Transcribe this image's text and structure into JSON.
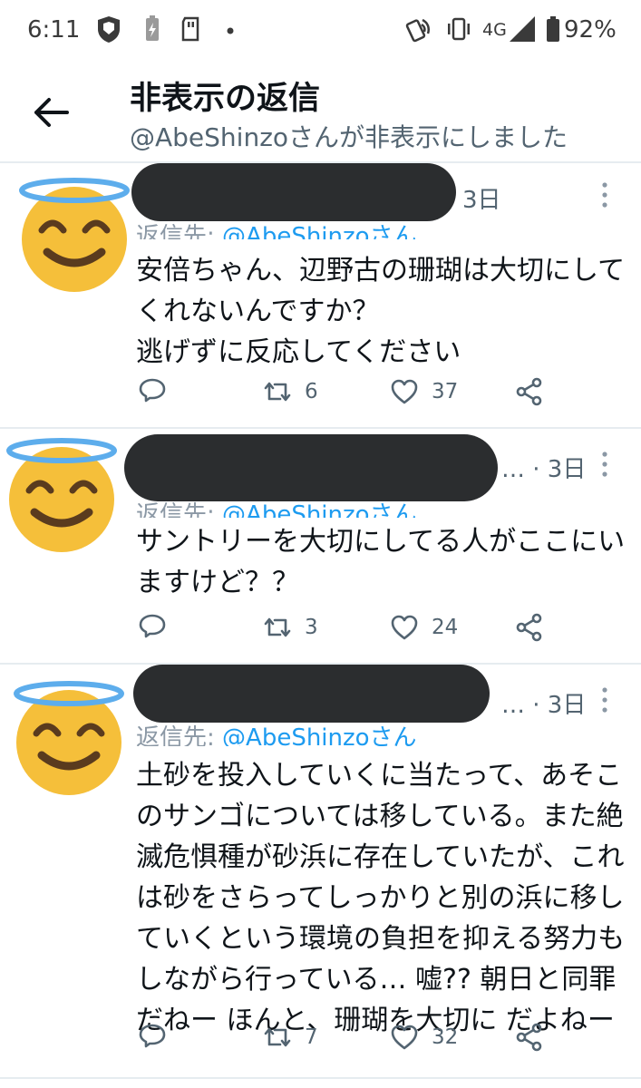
{
  "status_bar": {
    "time": "6:11",
    "network": "4G",
    "battery": "92%"
  },
  "header": {
    "title": "非表示の返信",
    "subtitle": "@AbeShinzoさんが非表示にしました"
  },
  "tweets": [
    {
      "time": "3日",
      "reply_prefix": "返信先: ",
      "reply_handle": "@AbeShinzoさん",
      "lines": [
        "安倍ちゃん、辺野古の珊瑚は大切にして",
        "くれないんですか？",
        "逃げずに反応してください"
      ],
      "retweets": "6",
      "likes": "37"
    },
    {
      "time": "… · 3日",
      "reply_prefix": "返信先: ",
      "reply_handle": "@AbeShinzoさん",
      "lines": [
        "サントリーを大切にしてる人がここにい",
        "ますけど？？"
      ],
      "retweets": "3",
      "likes": "24"
    },
    {
      "time": "… · 3日",
      "reply_prefix": "返信先: ",
      "reply_handle": "@AbeShinzoさん",
      "lines": [
        "土砂を投入していくに当たって、あそこ",
        "のサンゴについては移している。また絶",
        "滅危惧種が砂浜に存在していたが、これ",
        "は砂をさらってしっかりと別の浜に移し",
        "ていくという環境の負担を抑える努力も",
        "しながら行っている… 嘘?? 朝日と同罪",
        "だねー ほんと、珊瑚を大切に だよねー"
      ],
      "retweets": "7",
      "likes": "32"
    }
  ]
}
